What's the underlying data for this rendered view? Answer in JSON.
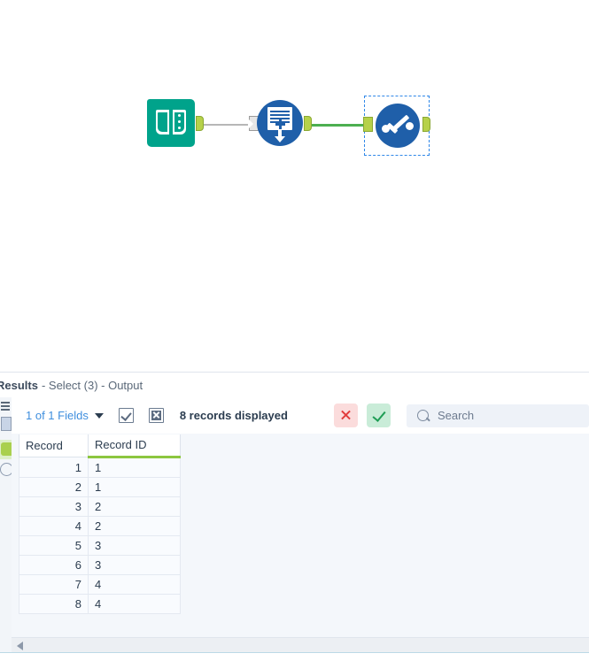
{
  "canvas": {
    "tools": [
      {
        "name": "Input Data",
        "icon": "book-icon",
        "color": "#00a38b"
      },
      {
        "name": "Select",
        "icon": "select-doc-icon",
        "color": "#1f5fa9"
      },
      {
        "name": "Browse",
        "icon": "browse-curve-icon",
        "color": "#1f5fa9",
        "selected": true
      }
    ],
    "connections": [
      {
        "from": "Input Data",
        "to": "Select",
        "color": "#b7b7b7"
      },
      {
        "from": "Select",
        "to": "Browse",
        "color": "#4caf50"
      }
    ]
  },
  "results": {
    "title": "Results",
    "subtitle": "- Select (3) - Output",
    "toolbar": {
      "fields_label": "1 of 1 Fields",
      "select_all_icon": "checkbox-checked-icon",
      "deselect_all_icon": "checkbox-x-icon",
      "records_text": "8 records displayed",
      "cancel_icon": "x-icon",
      "apply_icon": "check-icon",
      "search_placeholder": "Search",
      "search_value": "",
      "search_icon": "search-icon"
    },
    "grid": {
      "columns": [
        "Record",
        "Record ID"
      ],
      "rows": [
        {
          "record": "1",
          "record_id": "1"
        },
        {
          "record": "2",
          "record_id": "1"
        },
        {
          "record": "3",
          "record_id": "2"
        },
        {
          "record": "4",
          "record_id": "2"
        },
        {
          "record": "5",
          "record_id": "3"
        },
        {
          "record": "6",
          "record_id": "3"
        },
        {
          "record": "7",
          "record_id": "4"
        },
        {
          "record": "8",
          "record_id": "4"
        }
      ]
    },
    "scroll": {
      "left_arrow_icon": "triangle-left-icon"
    }
  },
  "colors": {
    "accent_blue": "#3e8ede",
    "tool_blue": "#1f5fa9",
    "tool_green": "#00a38b",
    "connector_green": "#4caf50",
    "anchor_green": "#b6d14a",
    "header_underline": "#8cc63f",
    "cancel_red": "#e23b3b",
    "apply_green": "#1f9d55"
  }
}
